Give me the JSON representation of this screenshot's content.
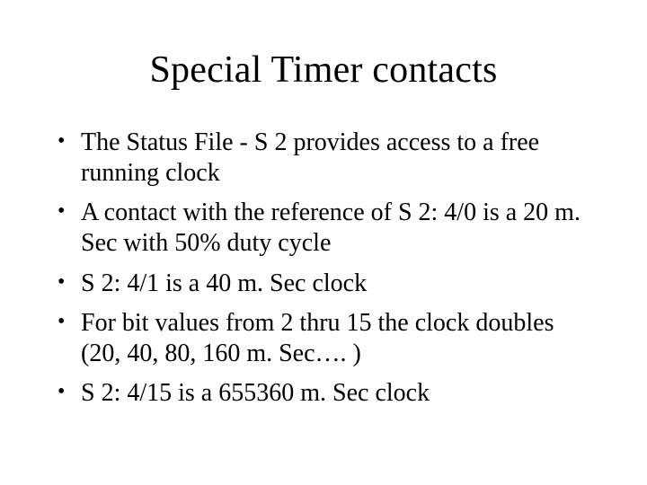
{
  "slide": {
    "title": "Special Timer contacts",
    "bullets": [
      "The Status File - S 2 provides access to a free running clock",
      "A contact with the reference of S 2: 4/0 is a 20 m. Sec  with 50% duty cycle",
      "S 2: 4/1 is a 40 m. Sec clock",
      "For bit values from 2 thru 15 the clock doubles (20, 40, 80, 160 m. Sec…. )",
      "S 2: 4/15 is a 655360 m. Sec clock"
    ]
  }
}
